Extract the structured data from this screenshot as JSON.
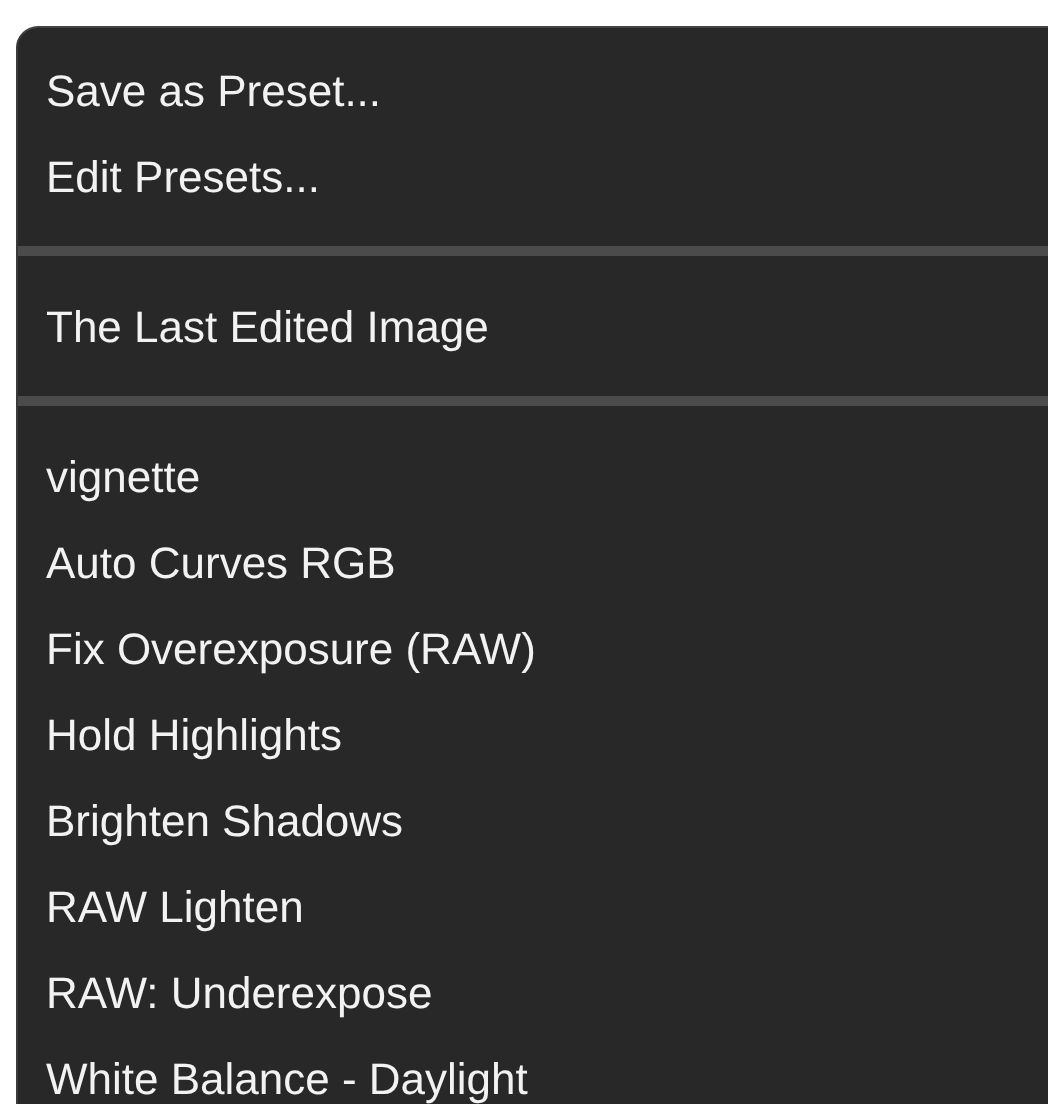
{
  "menu": {
    "sections": [
      {
        "items": [
          {
            "label": "Save as Preset..."
          },
          {
            "label": "Edit Presets..."
          }
        ]
      },
      {
        "items": [
          {
            "label": "The Last Edited Image"
          }
        ]
      },
      {
        "items": [
          {
            "label": "vignette"
          },
          {
            "label": "Auto Curves RGB"
          },
          {
            "label": "Fix Overexposure (RAW)"
          },
          {
            "label": "Hold Highlights"
          },
          {
            "label": "Brighten Shadows"
          },
          {
            "label": "RAW Lighten"
          },
          {
            "label": "RAW: Underexpose"
          },
          {
            "label": "White Balance - Daylight"
          }
        ]
      }
    ]
  }
}
